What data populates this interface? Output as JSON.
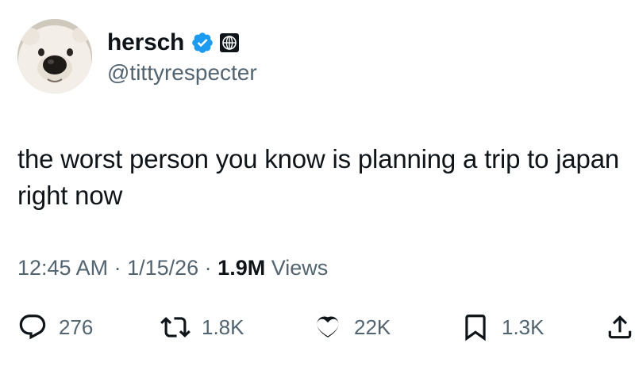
{
  "user": {
    "display_name": "hersch",
    "handle": "@tittyrespecter",
    "avatar": "polar-bear-avatar",
    "verified_color": "#1d9bf0"
  },
  "tweet": {
    "text": "the worst person you know is planning a trip to japan right now"
  },
  "meta": {
    "time": "12:45 AM",
    "sep1": " · ",
    "date": "1/15/26",
    "sep2": " · ",
    "views_count": "1.9M",
    "views_label": " Views"
  },
  "actions": {
    "reply": {
      "icon": "reply-icon",
      "count": "276"
    },
    "retweet": {
      "icon": "retweet-icon",
      "count": "1.8K"
    },
    "like": {
      "icon": "heart-icon",
      "count": "22K"
    },
    "bookmark": {
      "icon": "bookmark-icon",
      "count": "1.3K"
    },
    "share": {
      "icon": "share-icon"
    }
  },
  "colors": {
    "text": "#0f1419",
    "secondary": "#536471",
    "accent": "#1d9bf0"
  }
}
